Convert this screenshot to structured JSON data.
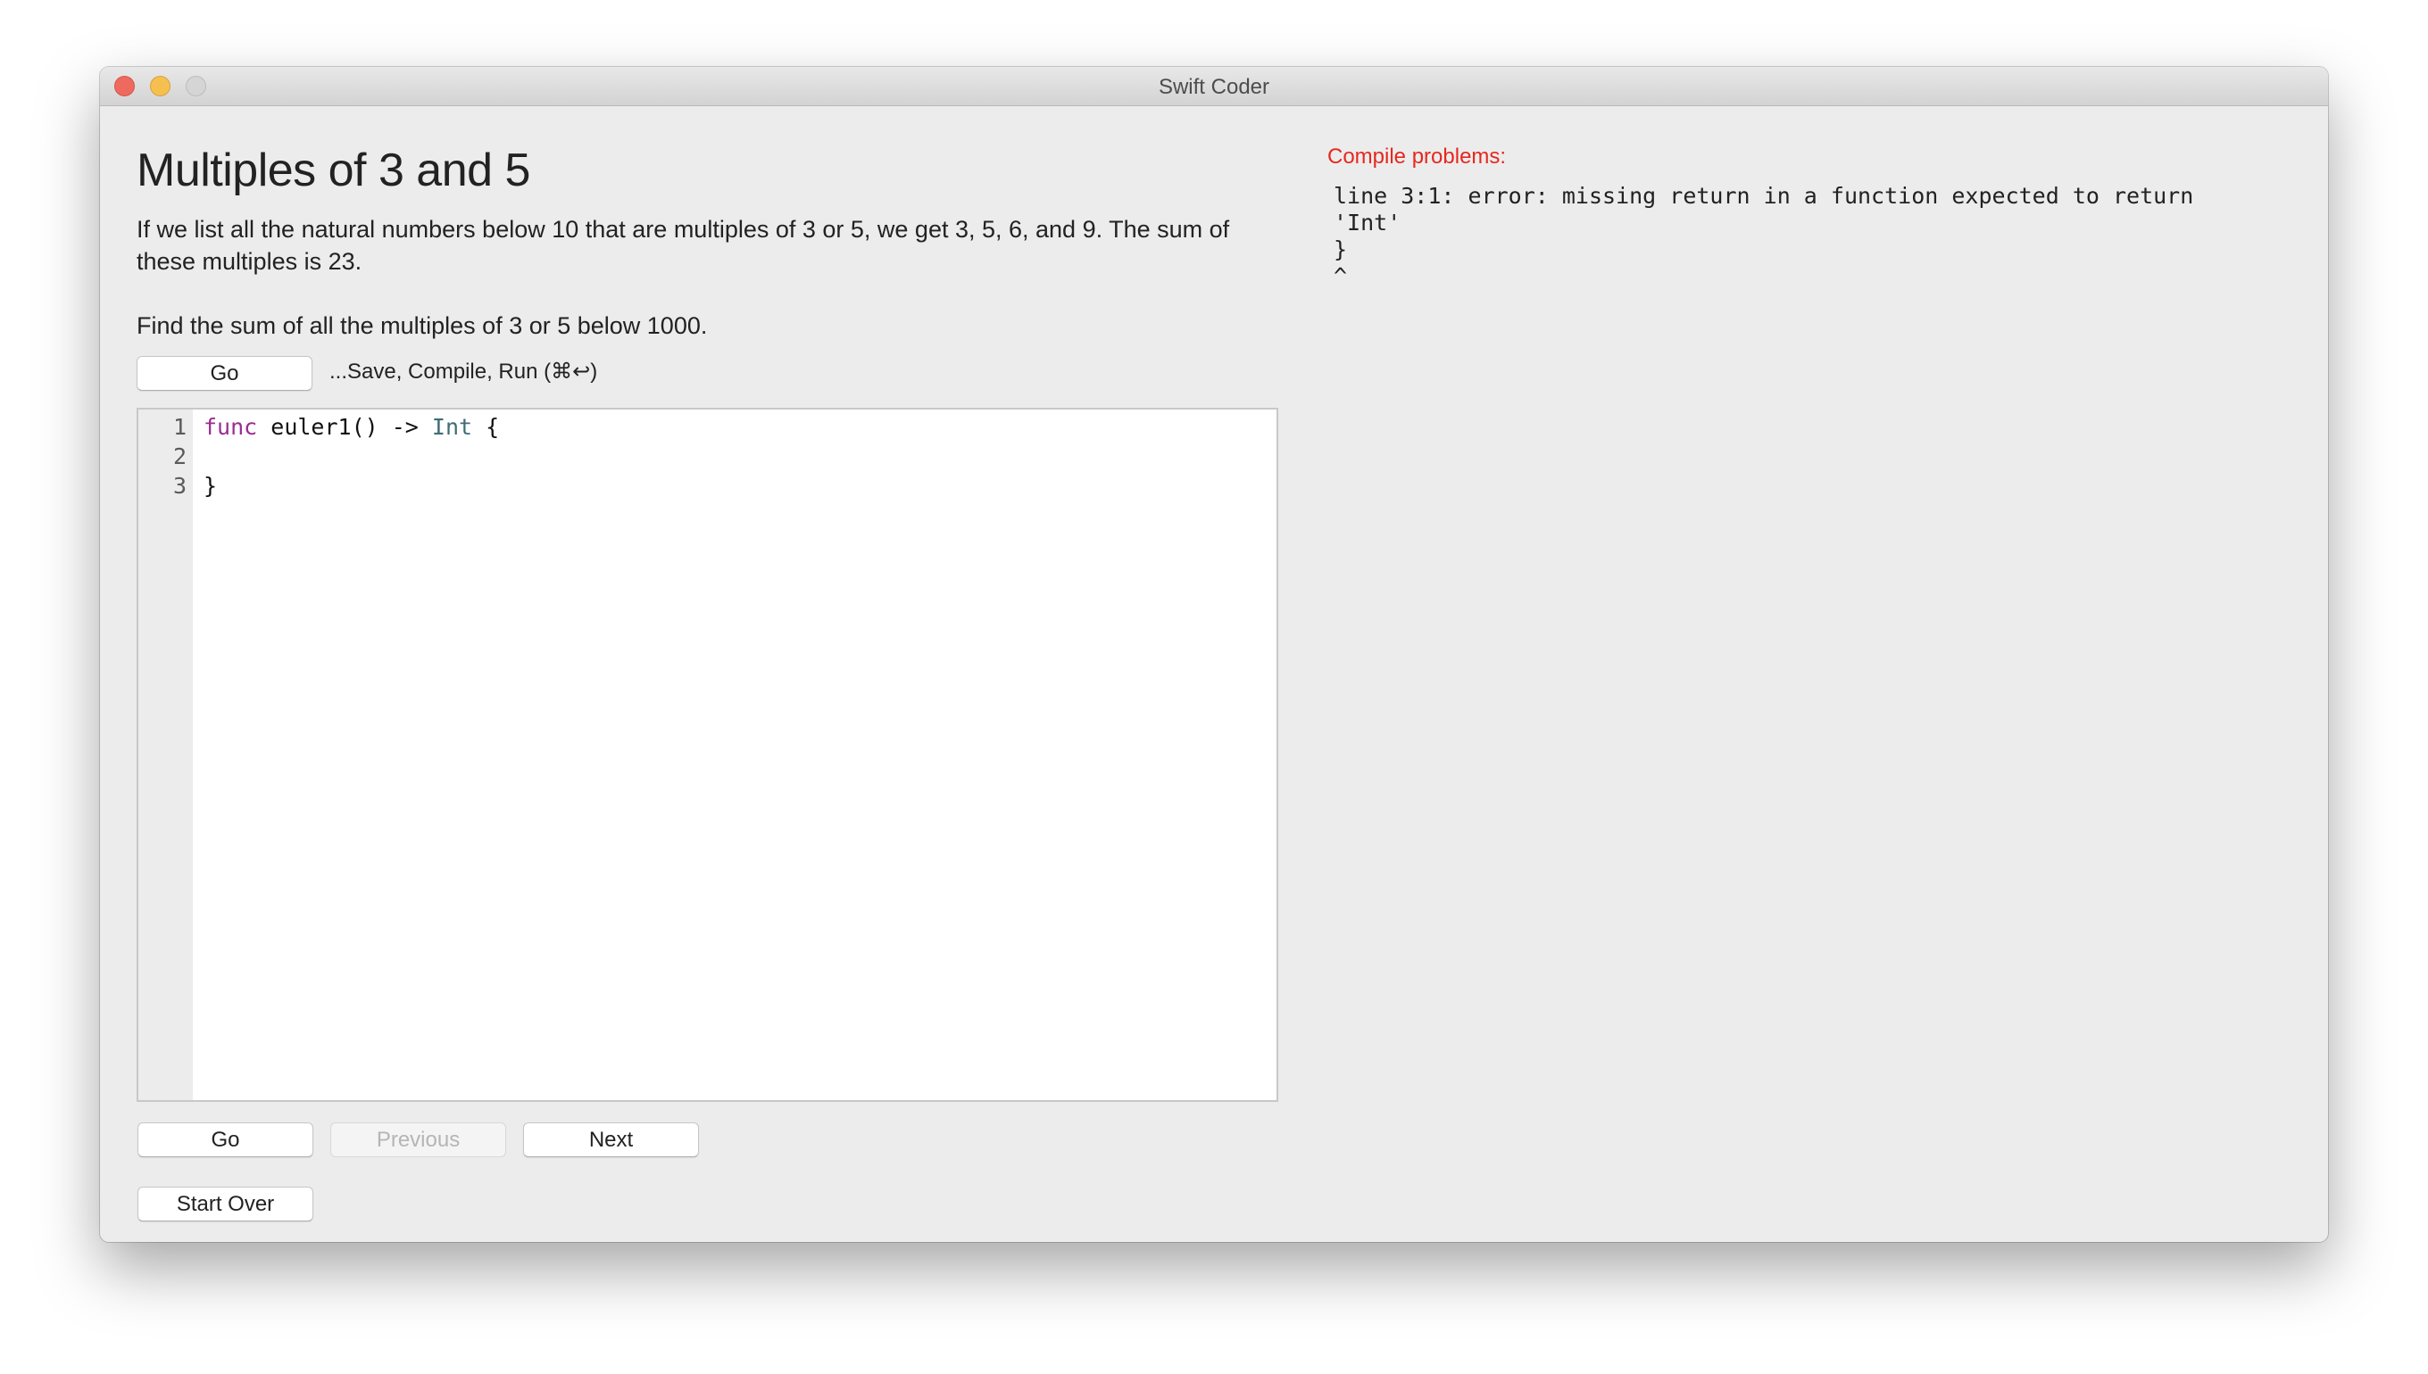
{
  "window": {
    "title": "Swift Coder",
    "controls": {
      "close": "close-button",
      "minimize": "minimize-button",
      "zoom": "zoom-button"
    }
  },
  "problem": {
    "title": "Multiples of 3 and 5",
    "description": "If we list all the natural numbers below 10 that are multiples of 3 or 5, we get 3, 5, 6, and 9. The sum of these multiples is 23.",
    "task": "Find the sum of all the multiples of 3 or 5 below 1000."
  },
  "toolbar": {
    "go_label": "Go",
    "hint": "...Save, Compile, Run (⌘↩)"
  },
  "editor": {
    "lines": [
      {
        "number": "1",
        "tokens": [
          {
            "text": "func",
            "kind": "keyword"
          },
          {
            "text": " euler1() -> ",
            "kind": "plain"
          },
          {
            "text": "Int",
            "kind": "type"
          },
          {
            "text": " {",
            "kind": "plain"
          }
        ]
      },
      {
        "number": "2",
        "tokens": []
      },
      {
        "number": "3",
        "tokens": [
          {
            "text": "}",
            "kind": "plain"
          }
        ]
      }
    ],
    "syntax_colors": {
      "keyword": "#9b2d8e",
      "type": "#3e6d74",
      "plain": "#111111"
    }
  },
  "navigation": {
    "go_label": "Go",
    "previous_label": "Previous",
    "previous_enabled": false,
    "next_label": "Next",
    "start_over_label": "Start Over"
  },
  "compile": {
    "label": "Compile problems:",
    "label_color": "#e5281f",
    "output": "line 3:1: error: missing return in a function expected to return\n'Int'\n}\n^"
  }
}
